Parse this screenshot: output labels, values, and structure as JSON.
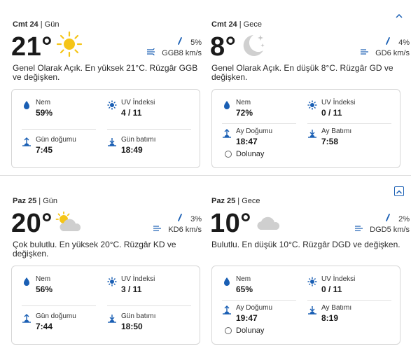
{
  "days": [
    {
      "day_periods": [
        {
          "day_label": "Cmt 24",
          "period": "Gün",
          "temperature": "21°",
          "condition_icon": "sun-icon",
          "precip": "5%",
          "wind": "GGB8 km/s",
          "summary": "Genel Olarak Açık. En yüksek 21°C. Rüzgâr GGB ve değişken.",
          "metrics": {
            "humidity_label": "Nem",
            "humidity_value": "59%",
            "uv_label": "UV İndeksi",
            "uv_value": "4 / 11",
            "rise_label": "Gün doğumu",
            "rise_value": "7:45",
            "set_label": "Gün batımı",
            "set_value": "18:49"
          }
        },
        {
          "day_label": "Cmt 24",
          "period": "Gece",
          "temperature": "8°",
          "condition_icon": "moon-stars-icon",
          "precip": "4%",
          "wind": "GD6 km/s",
          "summary": "Genel Olarak Açık. En düşük 8°C. Rüzgâr GD ve değişken.",
          "metrics": {
            "humidity_label": "Nem",
            "humidity_value": "72%",
            "uv_label": "UV İndeksi",
            "uv_value": "0 / 11",
            "rise_label": "Ay Doğumu",
            "rise_value": "18:47",
            "set_label": "Ay Batımı",
            "set_value": "7:58",
            "moon_phase": "Dolunay"
          }
        }
      ]
    },
    {
      "day_periods": [
        {
          "day_label": "Paz 25",
          "period": "Gün",
          "temperature": "20°",
          "condition_icon": "partly-cloudy-icon",
          "precip": "3%",
          "wind": "KD6 km/s",
          "summary": "Çok bulutlu. En yüksek 20°C. Rüzgâr KD ve değişken.",
          "metrics": {
            "humidity_label": "Nem",
            "humidity_value": "56%",
            "uv_label": "UV İndeksi",
            "uv_value": "3 / 11",
            "rise_label": "Gün doğumu",
            "rise_value": "7:44",
            "set_label": "Gün batımı",
            "set_value": "18:50"
          }
        },
        {
          "day_label": "Paz 25",
          "period": "Gece",
          "temperature": "10°",
          "condition_icon": "cloud-icon",
          "precip": "2%",
          "wind": "DGD5 km/s",
          "summary": "Bulutlu. En düşük 10°C. Rüzgâr DGD ve değişken.",
          "metrics": {
            "humidity_label": "Nem",
            "humidity_value": "65%",
            "uv_label": "UV İndeksi",
            "uv_value": "0 / 11",
            "rise_label": "Ay Doğumu",
            "rise_value": "19:47",
            "set_label": "Ay Batımı",
            "set_value": "8:19",
            "moon_phase": "Dolunay"
          }
        }
      ]
    }
  ],
  "colors": {
    "accent": "#1a5fb4",
    "sun": "#f5c518",
    "cloud": "#c8c8c8",
    "moon": "#d0d0d0"
  }
}
